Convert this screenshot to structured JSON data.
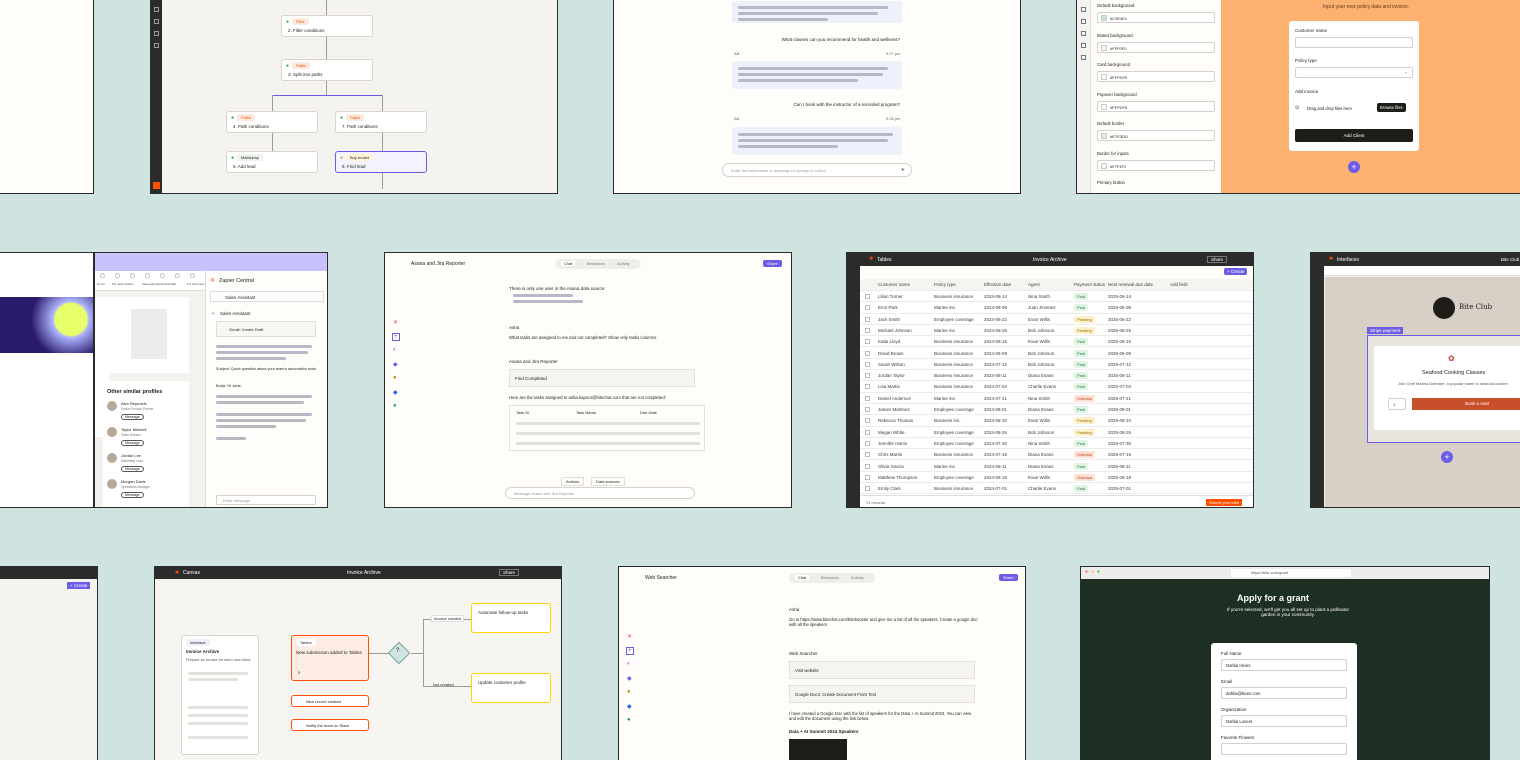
{
  "zapWorkflow": {
    "steps": [
      {
        "app": "Filter",
        "label": "2. Filter conditions"
      },
      {
        "app": "Paths",
        "label": "3. Split into paths"
      },
      {
        "app": "Paths",
        "label": "4. Path conditions"
      },
      {
        "app": "Paths",
        "label": "7. Path conditions"
      },
      {
        "app": "Mailchimp",
        "label": "5. Add lead"
      },
      {
        "app": "Buy ended",
        "label": "8. Find lead"
      }
    ]
  },
  "chatTop": {
    "q1": "What classes can you recommend for health and wellness?",
    "q2": "Can I book with the instructor of a recorded program?",
    "user": "AB",
    "t1": "9:27 pm",
    "t2": "9:28 pm",
    "placeholder": "Enter the information or message for people to collect"
  },
  "themeEditor": {
    "fields": [
      {
        "label": "Default background",
        "value": "#C3E4E1"
      },
      {
        "label": "Muted background",
        "value": "#FFF0F0"
      },
      {
        "label": "Card background",
        "value": "#FFFDF9"
      },
      {
        "label": "Popover background",
        "value": "#FFFDF9"
      },
      {
        "label": "Default border",
        "value": "#E7E3DD"
      },
      {
        "label": "Border for inputs",
        "value": "#F7F4F2"
      },
      {
        "label": "Primary button",
        "value": ""
      }
    ],
    "formIntro": "Input your new policy data and invoice.",
    "form": {
      "customer": "Customer name",
      "policy": "Policy type",
      "invoice": "Add invoice",
      "drag": "Drag and drop files here",
      "browse": "Browse files",
      "submit": "Add Client"
    }
  },
  "profile": {
    "nav": [
      "Home",
      "My network",
      "Jobs",
      "Messaging",
      "Notifications",
      "Me",
      "For Business",
      "Try Premium"
    ],
    "similar": "Other similar profiles",
    "people": [
      {
        "name": "Alex Reynolds",
        "role": "Senior Product Partner"
      },
      {
        "name": "Taylor Mitchell",
        "role": "Sales Director"
      },
      {
        "name": "Jordan Lee",
        "role": "Marketing Lead"
      },
      {
        "name": "Morgan Davis",
        "role": "Operations Manager"
      }
    ],
    "message": "Message",
    "panelTitle": "Zapier Central",
    "assistant": "Sales Assistant",
    "botName": "Sales Assistant",
    "tool": "Gmail: Create Draft",
    "subject": "Subject: Quick question about your team's automation tools",
    "body": "Body: Hi Jane,",
    "placeholder": "Enter message"
  },
  "jiraChat": {
    "title": "Asana and Jira Reporter",
    "tabs": [
      "Chat",
      "Behaviors",
      "Activity"
    ],
    "share": "Share",
    "intro": "There is only one user in the Asana data source:",
    "user": "Asha",
    "question": "What tasks are assigned to me and not completed? Show only tasks columns",
    "bot": "Asana and Jira Reporter",
    "tool": "Find Completed",
    "resultIntro": "Here are the tasks assigned to asha.kapoor@bitechat.com that are not completed:",
    "cols": [
      "Task ID",
      "Task Name",
      "Due Date"
    ],
    "actions": [
      "Actions",
      "Data sources"
    ],
    "placeholder": "Message Asana and Jira Reporter"
  },
  "tables": {
    "app": "Tables",
    "name": "Invoice Archive",
    "share": "Share",
    "create": "+ Create",
    "columns": [
      "Customer name",
      "Policy type",
      "Effective date",
      "Agent",
      "Payment status",
      "Next renewal due date",
      "Add field"
    ],
    "rows": [
      [
        "Lilian Turner",
        "Business insurance",
        "2024-06-14",
        "Nina Smith",
        "Paid",
        "2025-06-14"
      ],
      [
        "Emir Park",
        "Marine ins.",
        "2024-06-08",
        "Juan Jimenez",
        "Paid",
        "2025-06-08"
      ],
      [
        "Jack Smith",
        "Employee coverage",
        "2024-06-22",
        "Evan Willis",
        "Pending",
        "2025-06-22"
      ],
      [
        "Michael Johnson",
        "Marine ins.",
        "2024-06-25",
        "Bob Johnson",
        "Pending",
        "2025-06-25"
      ],
      [
        "Katie Lloyd",
        "Business insurance",
        "2024-06-15",
        "Evan Willis",
        "Paid",
        "2025-06-15"
      ],
      [
        "David Brown",
        "Business insurance",
        "2024-06-09",
        "Bob Johnson",
        "Paid",
        "2025-06-09"
      ],
      [
        "Sarah Wilson",
        "Business insurance",
        "2024-07-12",
        "Bob Johnson",
        "Paid",
        "2025-07-12"
      ],
      [
        "Jordan Taylor",
        "Business insurance",
        "2024-08-11",
        "Diana Evans",
        "Paid",
        "2025-08-11"
      ],
      [
        "Lisa Martin",
        "Business insurance",
        "2024-07-04",
        "Charlie Evans",
        "Paid",
        "2025-07-04"
      ],
      [
        "Daniel Anderson",
        "Marine ins.",
        "2024-07-21",
        "Nina Smith",
        "Overdue",
        "2025-07-21"
      ],
      [
        "James Martinez",
        "Employee coverage",
        "2024-08-01",
        "Diana Evans",
        "Paid",
        "2025-08-01"
      ],
      [
        "Rebecca Thomas",
        "Business ins.",
        "2024-08-10",
        "Evan Willis",
        "Pending",
        "2025-08-10"
      ],
      [
        "Megan White",
        "Employee coverage",
        "2024-08-26",
        "Bob Johnson",
        "Pending",
        "2025-08-26"
      ],
      [
        "Jennifer Harris",
        "Employee coverage",
        "2024-07-30",
        "Nina Smith",
        "Paid",
        "2025-07-30"
      ],
      [
        "Chris Martin",
        "Business insurance",
        "2024-07-15",
        "Diana Evans",
        "Overdue",
        "2025-07-15"
      ],
      [
        "Olivia Garcia",
        "Marine ins.",
        "2024-08-11",
        "Diana Evans",
        "Paid",
        "2025-08-11"
      ],
      [
        "Matthew Thompson",
        "Employee coverage",
        "2024-06-18",
        "Evan Willis",
        "Overdue",
        "2025-06-18"
      ],
      [
        "Emily Clark",
        "Business insurance",
        "2024-07-01",
        "Charlie Evans",
        "Paid",
        "2025-07-01"
      ]
    ],
    "submit": "Submit your idea",
    "footer": "74 records"
  },
  "interfaces": {
    "app": "Interfaces",
    "brand": "Bite Club",
    "label": "Stripe payment",
    "title": "Seafood Cooking Classes",
    "desc": "Join Chef Marina Delmare, a popular name in seafood cuisine",
    "qty": "1",
    "book": "Book a seat",
    "user": "Bite Club"
  },
  "canvas": {
    "app": "Canvas",
    "name": "Invoice Archive",
    "share": "Share",
    "interfaceNode": {
      "app": "Interface",
      "title": "Invoice Archive",
      "desc": "Prepare an invoice for each new client."
    },
    "tableNode": {
      "app": "Tables",
      "title": "New submission added to Tables",
      "count": "0"
    },
    "steps": [
      "New record created",
      "Notify the team on Slack"
    ],
    "branches": [
      "Invoice created",
      "Not created"
    ],
    "outA": "Automate follow-up tasks",
    "outB": "Update customer profile"
  },
  "webChat": {
    "title": "Web Searcher",
    "tabs": [
      "Chat",
      "Behaviors",
      "Activity"
    ],
    "share": "Share",
    "user": "Asha",
    "ask": "Go to https://www.bitechat.com/bitebooster and give me a list of all the speakers. Create a google doc with all the speakers",
    "bot": "Web Searcher",
    "tool1": "Visit website",
    "tool2": "Google Docs: Create Document From Text",
    "reply": "I have created a Google Doc with the list of speakers for the Data + AI Summit 2024. You can view and edit the document using the link below:",
    "heading": "Data + AI Summit 2024 Speakers"
  },
  "grant": {
    "url": "https://bite.club/grant",
    "title": "Apply for a grant",
    "sub": "If you're selected, we'll get you all set up to plant a pollinator garden in your community.",
    "fields": [
      {
        "label": "Full Name",
        "value": "Dahlia Hines"
      },
      {
        "label": "Email",
        "value": "dahlia@bees.com"
      },
      {
        "label": "Organization",
        "value": "Dahlia Lovers"
      },
      {
        "label": "Favorite Flowers",
        "value": ""
      }
    ]
  },
  "colors": {
    "orange": "#FF4F00",
    "purple": "#6B5DE6",
    "cream": "#FFFDF9",
    "teal": "#CFE3E0",
    "darkgreen": "#1D2E22",
    "peach": "#FDB171"
  }
}
